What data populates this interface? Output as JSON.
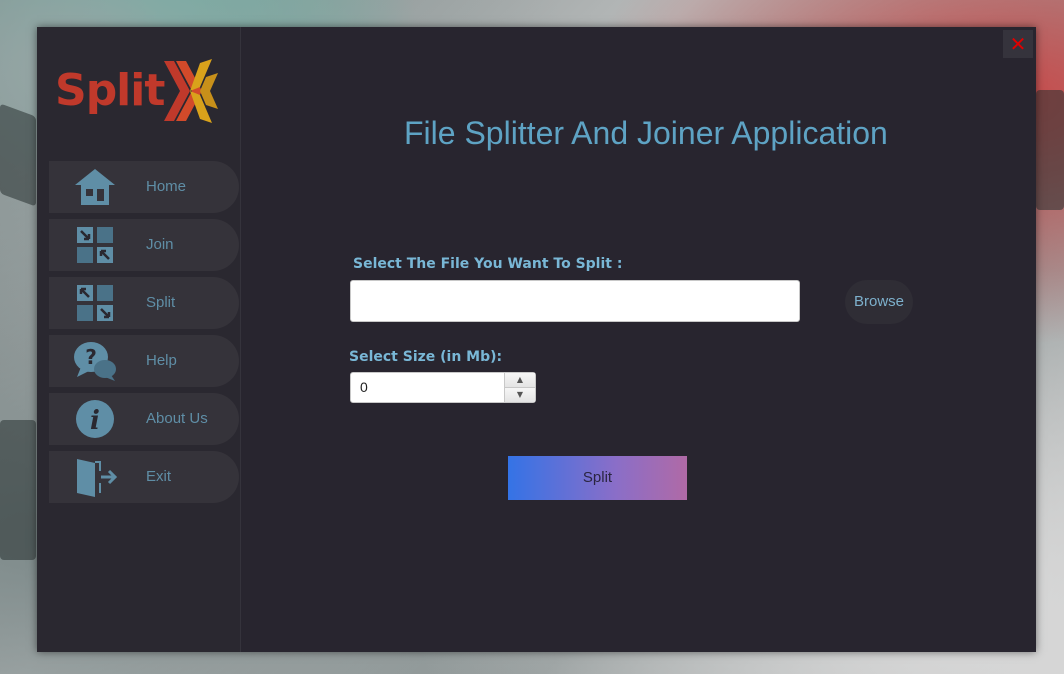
{
  "app": {
    "logo_text": "Split",
    "close_glyph": "✕"
  },
  "sidebar": {
    "items": [
      {
        "label": "Home",
        "icon": "home-icon"
      },
      {
        "label": "Join",
        "icon": "join-icon"
      },
      {
        "label": "Split",
        "icon": "split-icon"
      },
      {
        "label": "Help",
        "icon": "help-icon"
      },
      {
        "label": "About Us",
        "icon": "info-icon"
      },
      {
        "label": "Exit",
        "icon": "exit-icon"
      }
    ]
  },
  "main": {
    "title": "File Splitter And Joiner Application",
    "file_label": "Select The File You Want To Split :",
    "file_value": "",
    "browse_label": "Browse",
    "size_label": "Select Size  (in Mb):",
    "size_value": "0",
    "split_label": "Split"
  },
  "colors": {
    "window_bg": "#28252f",
    "accent_text": "#5ea3c4",
    "close_red": "#e00000",
    "logo_red": "#c0392b",
    "logo_gold": "#d9a21b"
  }
}
